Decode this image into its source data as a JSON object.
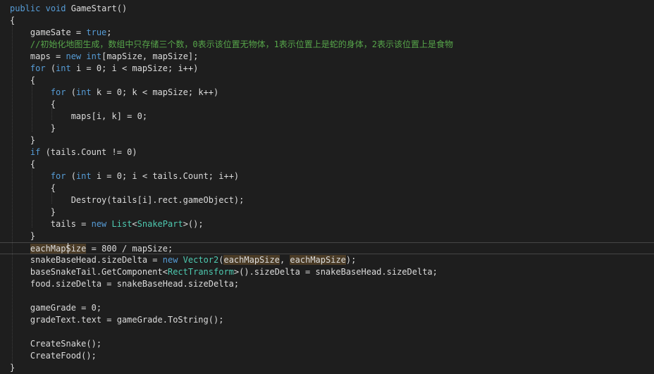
{
  "lines": [
    [
      {
        "t": "public",
        "c": "kw"
      },
      {
        "t": " ",
        "c": "plain"
      },
      {
        "t": "void",
        "c": "kw"
      },
      {
        "t": " GameStart()",
        "c": "plain"
      }
    ],
    [
      {
        "t": "{",
        "c": "plain"
      }
    ],
    [
      {
        "t": "    gameSate = ",
        "c": "plain"
      },
      {
        "t": "true",
        "c": "kw"
      },
      {
        "t": ";",
        "c": "plain"
      }
    ],
    [
      {
        "t": "    //初始化地图生成，数组中只存储三个数，0表示该位置无物体，1表示位置上是蛇的身体，2表示该位置上是食物",
        "c": "comment"
      }
    ],
    [
      {
        "t": "    maps = ",
        "c": "plain"
      },
      {
        "t": "new",
        "c": "kw"
      },
      {
        "t": " ",
        "c": "plain"
      },
      {
        "t": "int",
        "c": "kw"
      },
      {
        "t": "[mapSize, mapSize];",
        "c": "plain"
      }
    ],
    [
      {
        "t": "    ",
        "c": "plain"
      },
      {
        "t": "for",
        "c": "kw"
      },
      {
        "t": " (",
        "c": "plain"
      },
      {
        "t": "int",
        "c": "kw"
      },
      {
        "t": " i = 0; i < mapSize; i++)",
        "c": "plain"
      }
    ],
    [
      {
        "t": "    {",
        "c": "plain"
      }
    ],
    [
      {
        "t": "        ",
        "c": "plain"
      },
      {
        "t": "for",
        "c": "kw"
      },
      {
        "t": " (",
        "c": "plain"
      },
      {
        "t": "int",
        "c": "kw"
      },
      {
        "t": " k = 0; k < mapSize; k++)",
        "c": "plain"
      }
    ],
    [
      {
        "t": "        {",
        "c": "plain"
      }
    ],
    [
      {
        "t": "            maps[i, k] = 0;",
        "c": "plain"
      }
    ],
    [
      {
        "t": "        }",
        "c": "plain"
      }
    ],
    [
      {
        "t": "    }",
        "c": "plain"
      }
    ],
    [
      {
        "t": "    ",
        "c": "plain"
      },
      {
        "t": "if",
        "c": "kw"
      },
      {
        "t": " (tails.Count != 0)",
        "c": "plain"
      }
    ],
    [
      {
        "t": "    {",
        "c": "plain"
      }
    ],
    [
      {
        "t": "        ",
        "c": "plain"
      },
      {
        "t": "for",
        "c": "kw"
      },
      {
        "t": " (",
        "c": "plain"
      },
      {
        "t": "int",
        "c": "kw"
      },
      {
        "t": " i = 0; i < tails.Count; i++)",
        "c": "plain"
      }
    ],
    [
      {
        "t": "        {",
        "c": "plain"
      }
    ],
    [
      {
        "t": "            Destroy(tails[i].rect.gameObject);",
        "c": "plain"
      }
    ],
    [
      {
        "t": "        }",
        "c": "plain"
      }
    ],
    [
      {
        "t": "        tails = ",
        "c": "plain"
      },
      {
        "t": "new",
        "c": "kw"
      },
      {
        "t": " ",
        "c": "plain"
      },
      {
        "t": "List",
        "c": "type"
      },
      {
        "t": "<",
        "c": "plain"
      },
      {
        "t": "SnakePart",
        "c": "type"
      },
      {
        "t": ">();",
        "c": "plain"
      }
    ],
    [
      {
        "t": "    }",
        "c": "plain"
      }
    ],
    [
      {
        "t": "    ",
        "c": "plain"
      },
      {
        "t": "eachMapSize",
        "c": "hl"
      },
      {
        "t": " = 800 / mapSize;",
        "c": "plain"
      }
    ],
    [
      {
        "t": "    snakeBaseHead.sizeDelta = ",
        "c": "plain"
      },
      {
        "t": "new",
        "c": "kw"
      },
      {
        "t": " ",
        "c": "plain"
      },
      {
        "t": "Vector2",
        "c": "type"
      },
      {
        "t": "(",
        "c": "plain"
      },
      {
        "t": "eachMapSize",
        "c": "hl"
      },
      {
        "t": ", ",
        "c": "plain"
      },
      {
        "t": "eachMapSize",
        "c": "hl"
      },
      {
        "t": ");",
        "c": "plain"
      }
    ],
    [
      {
        "t": "    baseSnakeTail.GetComponent<",
        "c": "plain"
      },
      {
        "t": "RectTransform",
        "c": "type"
      },
      {
        "t": ">().sizeDelta = snakeBaseHead.sizeDelta;",
        "c": "plain"
      }
    ],
    [
      {
        "t": "    food.sizeDelta = snakeBaseHead.sizeDelta;",
        "c": "plain"
      }
    ],
    [
      {
        "t": "",
        "c": "plain"
      }
    ],
    [
      {
        "t": "    gameGrade = 0;",
        "c": "plain"
      }
    ],
    [
      {
        "t": "    gradeText.text = gameGrade.ToString();",
        "c": "plain"
      }
    ],
    [
      {
        "t": "",
        "c": "plain"
      }
    ],
    [
      {
        "t": "    CreateSnake();",
        "c": "plain"
      }
    ],
    [
      {
        "t": "    CreateFood();",
        "c": "plain"
      }
    ],
    [
      {
        "t": "}",
        "c": "plain"
      }
    ]
  ],
  "current_line": 20
}
